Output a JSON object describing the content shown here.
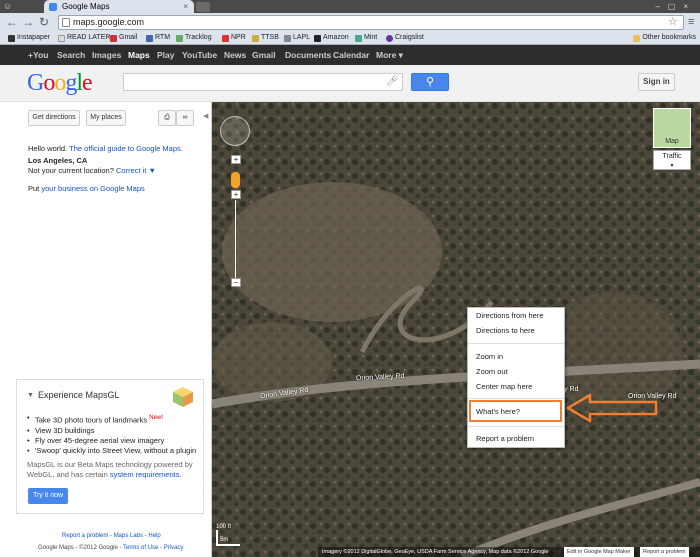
{
  "browser": {
    "tab_title": "Google Maps",
    "url": "maps.google.com",
    "bookmarks": [
      "Instapaper",
      "READ LATER",
      "Gmail",
      "RTM",
      "Tracklog",
      "NPR",
      "TTSB",
      "LAPL",
      "Amazon",
      "Mint",
      "Craigslist"
    ],
    "other_bookmarks": "Other bookmarks"
  },
  "google_bar": [
    "+You",
    "Search",
    "Images",
    "Maps",
    "Play",
    "YouTube",
    "News",
    "Gmail",
    "Documents",
    "Calendar",
    "More ▾"
  ],
  "header": {
    "logo": "Google",
    "signin": "Sign in"
  },
  "panel": {
    "get_directions": "Get directions",
    "my_places": "My places",
    "hello_text": "Hello world.",
    "guide_link": "The official guide to Google Maps.",
    "location": "Los Angeles, CA",
    "not_current": "Not your current location?",
    "correct_it": "Correct it ▼",
    "put_prefix": "Put",
    "business_link": "your business on Google Maps",
    "mapsgl": {
      "title": "Experience MapsGL",
      "items": [
        "Take 3D photo tours of landmarks",
        "View 3D buildings",
        "Fly over 45-degree aerial view imagery",
        "'Swoop' quickly into Street View, without a plugin"
      ],
      "new_badge": "New!",
      "desc": "MapsGL is our Beta Maps technology powered by WebGL, and has certain",
      "req_link": "system requirements.",
      "try_button": "Try it now"
    },
    "footer_links": "Report a problem - Maps Labs - Help",
    "footer_copy": "Google Maps - ©2012 Google -",
    "terms": "Terms of Use",
    "privacy": "Privacy"
  },
  "map": {
    "map_type": "Map",
    "traffic": "Traffic",
    "road_labels": [
      "Orion Valley Rd",
      "Orion Valley Rd",
      "Orion Valley Rd",
      "Orion Valley Rd"
    ],
    "scale": "100 ft",
    "scale_m": "5m",
    "attribution": "Imagery ©2012 DigitalGlobe, GeoEye, USDA Farm Service Agency, Map data ©2012 Google",
    "edit_link": "Edit in Google Map Maker",
    "report_link": "Report a problem"
  },
  "context_menu": {
    "items": [
      "Directions from here",
      "Directions to here",
      "Zoom in",
      "Zoom out",
      "Center map here",
      "What's here?",
      "Report a problem"
    ]
  },
  "colors": {
    "highlight": "#f08030",
    "google_blue": "#4787ed",
    "link": "#1155cc"
  }
}
